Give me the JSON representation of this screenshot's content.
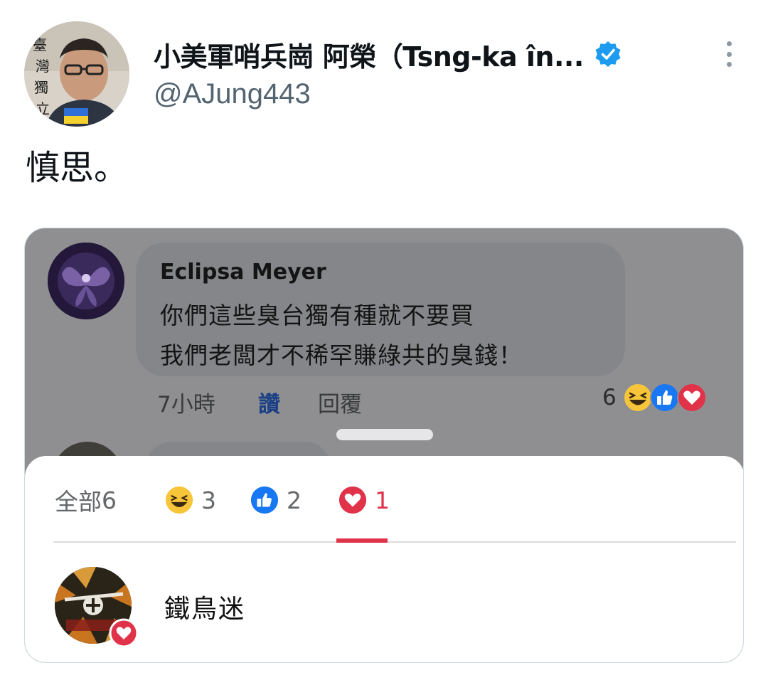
{
  "tweet": {
    "author_name": "小美軍哨兵崗 阿榮（Tsng-ka în...",
    "handle": "@AJung443",
    "text": "慎思。",
    "verified": true,
    "icons": {
      "verified": "verified-badge-icon",
      "more": "more-options-icon"
    }
  },
  "media": {
    "comment": {
      "author": "Eclipsa Meyer",
      "lines": [
        "你們這些臭台獨有種就不要買",
        "我們老闆才不稀罕賺綠共的臭錢！"
      ],
      "time": "7小時",
      "like_label": "讚",
      "reply_label": "回覆",
      "reaction_total": "6",
      "reaction_icons": [
        "haha-reaction-icon",
        "like-reaction-icon",
        "love-reaction-icon"
      ]
    },
    "reactions_sheet": {
      "tabs": [
        {
          "label": "全部",
          "count": "6",
          "icon": null
        },
        {
          "label": "",
          "count": "3",
          "icon": "haha-reaction-icon"
        },
        {
          "label": "",
          "count": "2",
          "icon": "like-reaction-icon"
        },
        {
          "label": "",
          "count": "1",
          "icon": "love-reaction-icon",
          "selected": true
        }
      ],
      "reactors": [
        {
          "name": "鐵鳥迷",
          "reaction": "love-reaction-icon"
        }
      ]
    }
  },
  "colors": {
    "verified_blue": "#1d9bf0",
    "handle_gray": "#536471",
    "love_red": "#e0334a",
    "like_blue": "#1877f2",
    "haha_yellow": "#f7c53a",
    "media_overlay": "#8f8f91"
  }
}
